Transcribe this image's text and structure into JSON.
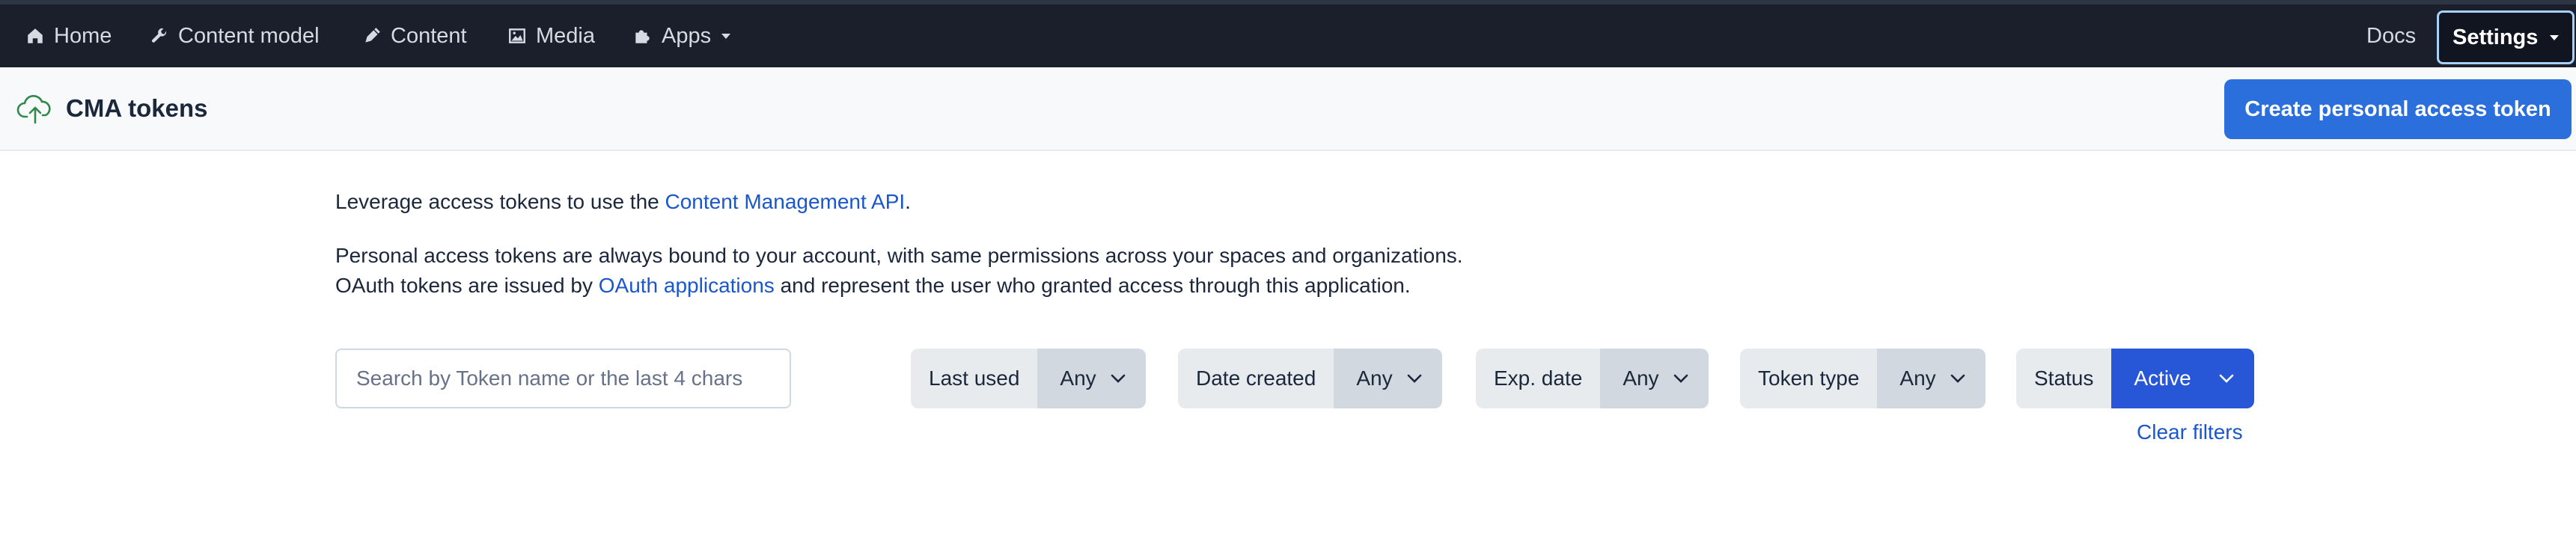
{
  "nav": {
    "items": [
      {
        "label": "Home",
        "icon": "home-icon"
      },
      {
        "label": "Content model",
        "icon": "wrench-icon"
      },
      {
        "label": "Content",
        "icon": "pen-icon"
      },
      {
        "label": "Media",
        "icon": "image-icon"
      },
      {
        "label": "Apps",
        "icon": "puzzle-icon"
      }
    ],
    "docs": "Docs",
    "settings": "Settings"
  },
  "header": {
    "title": "CMA tokens",
    "icon": "cloud-upload-icon",
    "create_button": "Create personal access token"
  },
  "intro": {
    "line1_before": "Leverage access tokens to use the ",
    "line1_link": "Content Management API",
    "line1_after": ".",
    "line2": "Personal access tokens are always bound to your account, with same permissions across your spaces and organizations.",
    "line3_before": "OAuth tokens are issued by ",
    "line3_link": "OAuth applications",
    "line3_after": " and represent the user who granted access through this application."
  },
  "search": {
    "placeholder": "Search by Token name or the last 4 chars",
    "value": ""
  },
  "filters": [
    {
      "label": "Last used",
      "value": "Any"
    },
    {
      "label": "Date created",
      "value": "Any"
    },
    {
      "label": "Exp. date",
      "value": "Any"
    },
    {
      "label": "Token type",
      "value": "Any"
    },
    {
      "label": "Status",
      "value": "Active"
    }
  ],
  "clear_filters": "Clear filters",
  "colors": {
    "topbar": "#1b1f2b",
    "primary": "#2b6fdc",
    "link": "#1a57cc",
    "active_filter": "#2756d7"
  }
}
